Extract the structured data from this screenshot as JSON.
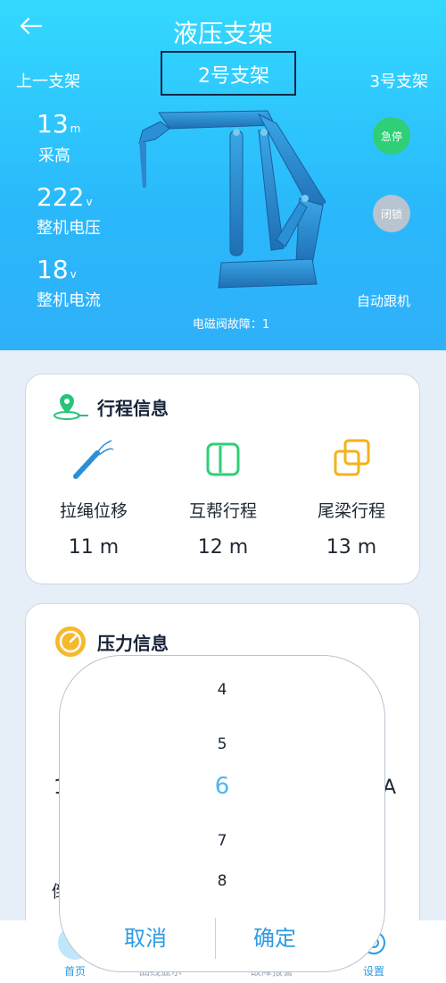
{
  "header": {
    "title": "液压支架",
    "prev_label": "上一支架",
    "current_label": "2号支架",
    "next_label": "3号支架"
  },
  "stats": [
    {
      "value": "13",
      "unit": "m",
      "label": "采高"
    },
    {
      "value": "222",
      "unit": "v",
      "label": "整机电压"
    },
    {
      "value": "18",
      "unit": "v",
      "label": "整机电流"
    }
  ],
  "buttons": {
    "emergency_stop": "急停",
    "lock": "闭锁",
    "auto_follow": "自动跟机"
  },
  "fault_text": "电磁阀故障：1",
  "travel": {
    "title": "行程信息",
    "items": [
      {
        "label": "拉绳位移",
        "value": "11 m"
      },
      {
        "label": "互帮行程",
        "value": "12 m"
      },
      {
        "label": "尾梁行程",
        "value": "13 m"
      }
    ]
  },
  "pressure": {
    "title": "压力信息",
    "partial_left_1": "1",
    "partial_right_1": "A",
    "partial_left_2": "倒"
  },
  "picker": {
    "options": [
      "4",
      "5",
      "6",
      "7",
      "8"
    ],
    "selected": "6",
    "cancel_label": "取消",
    "confirm_label": "确定"
  },
  "tabbar": {
    "items": [
      {
        "label": "首页",
        "partial_label": "首页"
      },
      {
        "label": "曲线显示"
      },
      {
        "label": "故障报警"
      },
      {
        "label": "设置"
      }
    ]
  },
  "colors": {
    "hero_top": "#33d9ff",
    "hero_bottom": "#2fb0f9",
    "green_button": "#2ecf76",
    "gray_button": "#b8c4cf",
    "accent": "#2e9be0",
    "picker_selected": "#4db6ef"
  }
}
